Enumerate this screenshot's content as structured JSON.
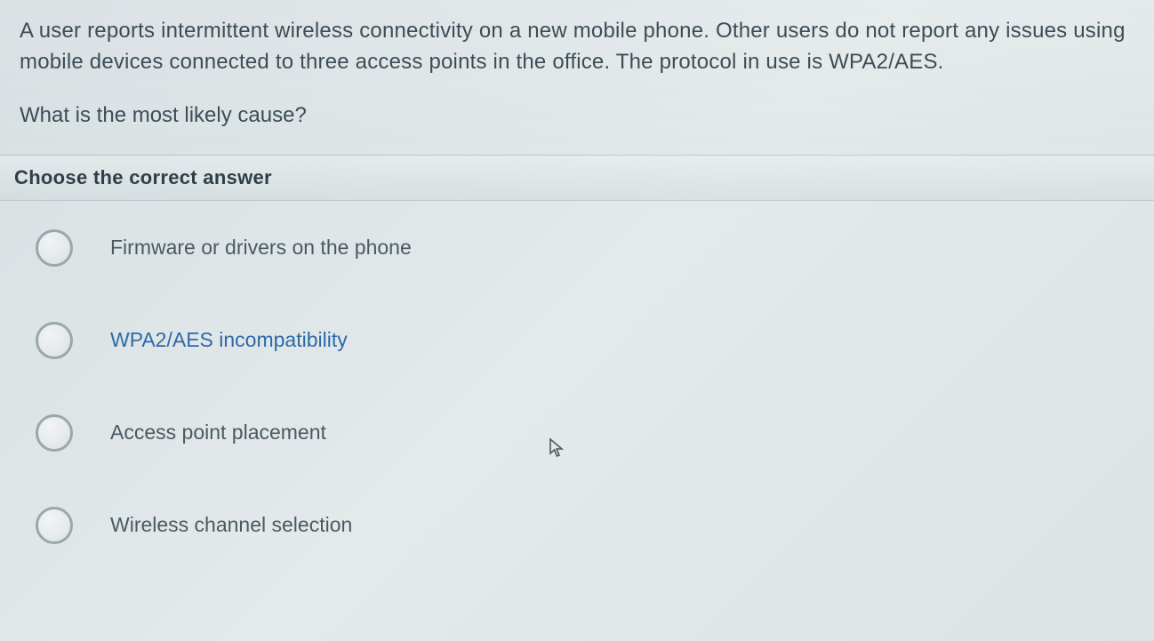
{
  "question": {
    "scenario": "A user reports intermittent wireless connectivity on a new mobile phone. Other users do not report any issues using mobile devices connected to three access points in the office. The protocol in use is WPA2/AES.",
    "prompt": "What is the most likely cause?"
  },
  "instruction": "Choose the correct answer",
  "options": [
    {
      "label": "Firmware or drivers on the phone",
      "hovered": false
    },
    {
      "label": "WPA2/AES incompatibility",
      "hovered": true
    },
    {
      "label": "Access point placement",
      "hovered": false
    },
    {
      "label": "Wireless channel selection",
      "hovered": false
    }
  ]
}
